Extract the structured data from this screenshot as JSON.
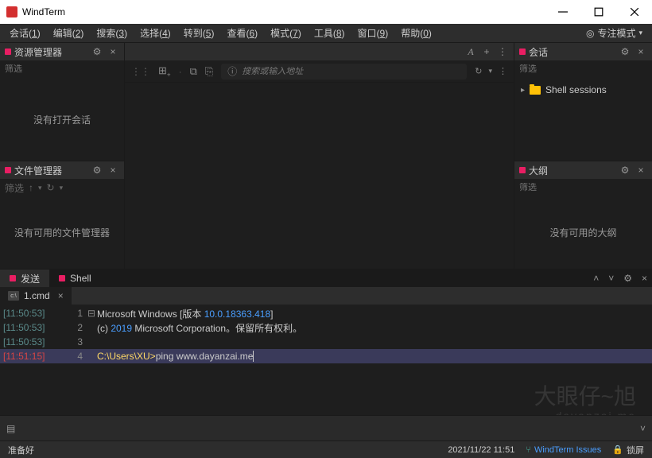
{
  "window": {
    "title": "WindTerm"
  },
  "menu": {
    "items": [
      {
        "label": "会话",
        "key": "1"
      },
      {
        "label": "编辑",
        "key": "2"
      },
      {
        "label": "搜索",
        "key": "3"
      },
      {
        "label": "选择",
        "key": "4"
      },
      {
        "label": "转到",
        "key": "5"
      },
      {
        "label": "查看",
        "key": "6"
      },
      {
        "label": "模式",
        "key": "7"
      },
      {
        "label": "工具",
        "key": "8"
      },
      {
        "label": "窗口",
        "key": "9"
      },
      {
        "label": "帮助",
        "key": "0"
      }
    ],
    "focus_mode": "专注模式"
  },
  "panels": {
    "explorer": {
      "title": "资源管理器",
      "filter": "筛选",
      "empty": "没有打开会话"
    },
    "filemgr": {
      "title": "文件管理器",
      "filter": "筛选",
      "empty": "没有可用的文件管理器"
    },
    "sessions": {
      "title": "会话",
      "filter": "筛选",
      "items": [
        {
          "label": "Shell sessions"
        }
      ]
    },
    "outline": {
      "title": "大纲",
      "filter": "筛选",
      "empty": "没有可用的大纲"
    }
  },
  "address": {
    "placeholder": "搜索或输入地址"
  },
  "bottom": {
    "tabs": [
      {
        "label": "发送",
        "active": true
      },
      {
        "label": "Shell",
        "active": false
      }
    ],
    "subtab": {
      "label": "1.cmd"
    }
  },
  "terminal": {
    "lines": [
      {
        "ts": "[11:50:53]",
        "ln": "1",
        "fold": "⊟",
        "segments": [
          {
            "t": "Microsoft Windows [版本 ",
            "c": "#ccc"
          },
          {
            "t": "10.0.18363.418",
            "c": "#4a9eff"
          },
          {
            "t": "]",
            "c": "#ccc"
          }
        ]
      },
      {
        "ts": "[11:50:53]",
        "ln": "2",
        "fold": "",
        "segments": [
          {
            "t": "(c) ",
            "c": "#ccc"
          },
          {
            "t": "2019",
            "c": "#4a9eff"
          },
          {
            "t": " Microsoft Corporation。保留所有权利。",
            "c": "#ccc"
          }
        ]
      },
      {
        "ts": "[11:50:53]",
        "ln": "3",
        "fold": "",
        "segments": []
      },
      {
        "ts": "[11:51:15]",
        "ln": "4",
        "fold": "",
        "active": true,
        "segments": [
          {
            "t": "C:\\Users\\XU>",
            "c": "#ffd966"
          },
          {
            "t": "ping  www.dayanzai.me",
            "c": "#ccc"
          }
        ]
      }
    ]
  },
  "status": {
    "ready": "准备好",
    "datetime": "2021/11/22  11:51",
    "link": "WindTerm Issues",
    "lock": "锁屏"
  },
  "watermark": {
    "main": "大眼仔~旭",
    "sub": "dayanzai.me"
  }
}
